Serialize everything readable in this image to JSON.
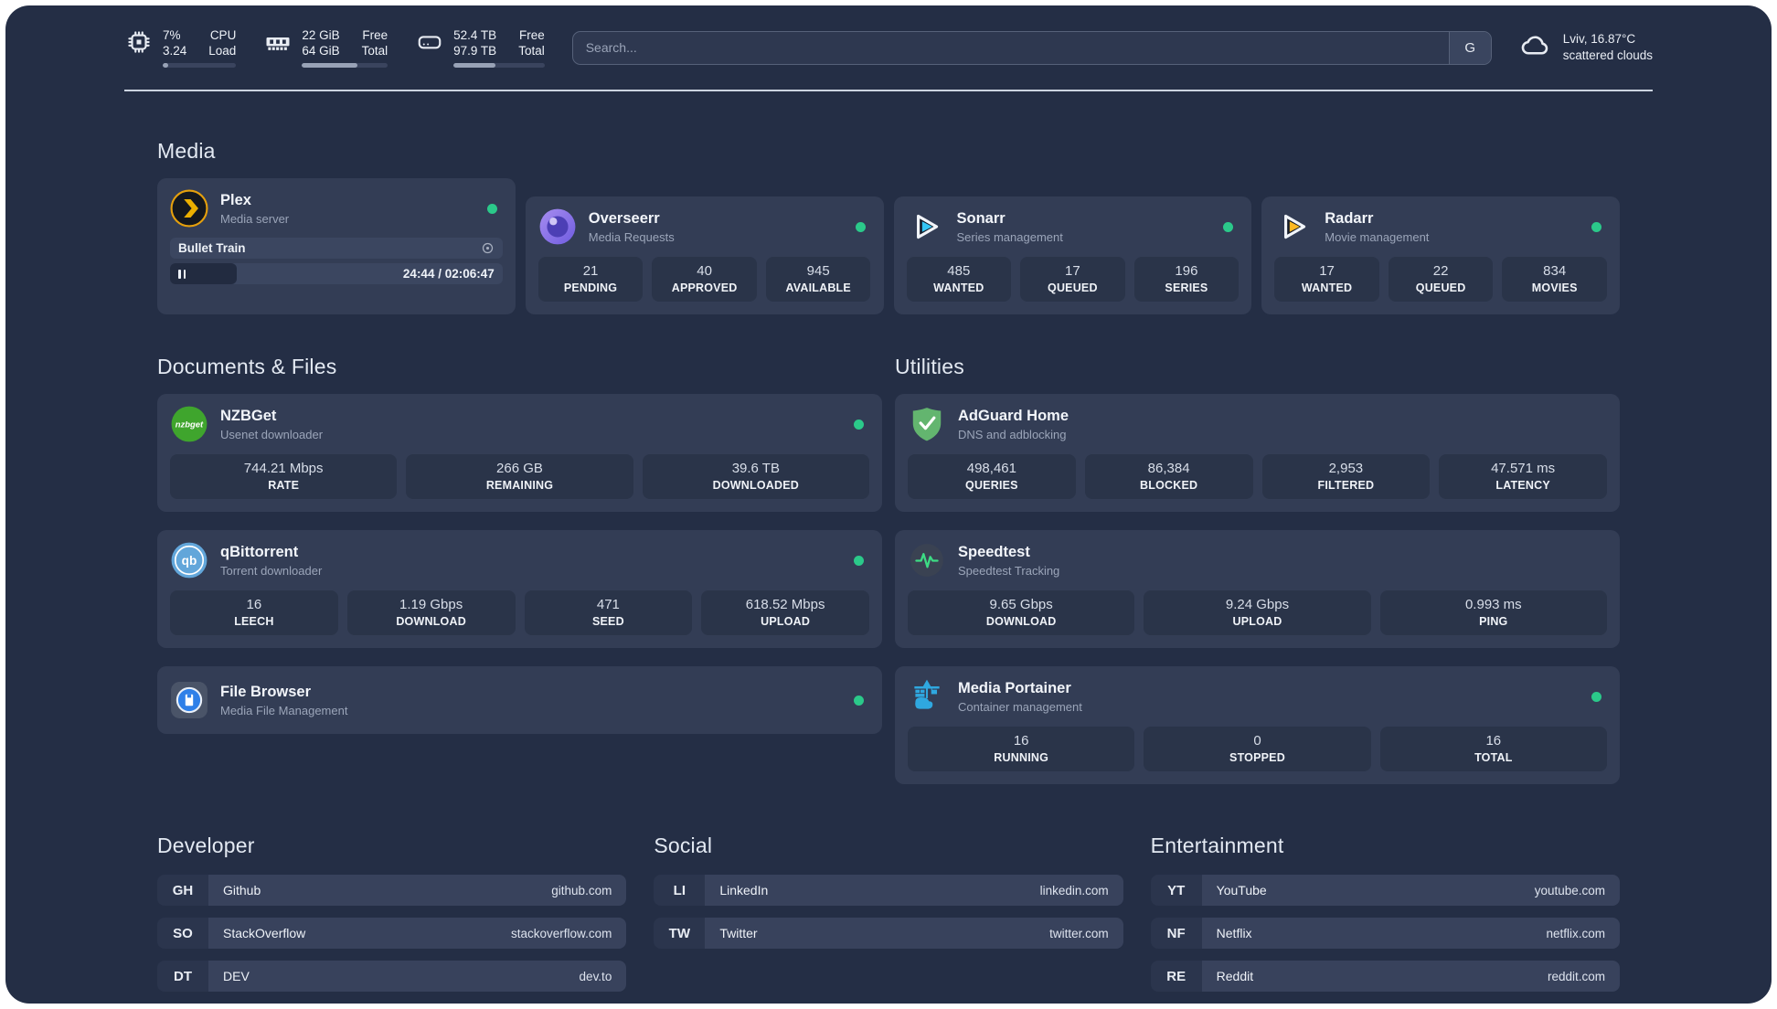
{
  "header": {
    "cpu": {
      "icon": "cpu-icon",
      "values": [
        "7%",
        "3.24"
      ],
      "labels": [
        "CPU",
        "Load"
      ],
      "progress": 7
    },
    "memory": {
      "icon": "ram-icon",
      "values": [
        "22 GiB",
        "64 GiB"
      ],
      "labels": [
        "Free",
        "Total"
      ],
      "progress": 65
    },
    "disk": {
      "icon": "disk-icon",
      "values": [
        "52.4 TB",
        "97.9 TB"
      ],
      "labels": [
        "Free",
        "Total"
      ],
      "progress": 46
    },
    "search": {
      "placeholder": "Search...",
      "engine_button": "G"
    },
    "weather": {
      "icon": "cloud-icon",
      "location": "Lviv, 16.87°C",
      "condition": "scattered clouds"
    }
  },
  "colors": {
    "status_online": "#2bc98a",
    "background": "#242e45",
    "card": "#333d55",
    "tile": "#2a3449"
  },
  "sections": {
    "media": {
      "title": "Media",
      "cards": [
        {
          "title": "Plex",
          "subtitle": "Media server",
          "icon": "plex-icon",
          "status": "online",
          "player": {
            "title": "Bullet Train",
            "time": "24:44 / 02:06:47",
            "progress_pct": 20
          }
        },
        {
          "title": "Overseerr",
          "subtitle": "Media Requests",
          "icon": "overseerr-icon",
          "status": "online",
          "stats": [
            {
              "value": "21",
              "label": "PENDING"
            },
            {
              "value": "40",
              "label": "APPROVED"
            },
            {
              "value": "945",
              "label": "AVAILABLE"
            }
          ]
        },
        {
          "title": "Sonarr",
          "subtitle": "Series management",
          "icon": "sonarr-icon",
          "status": "online",
          "stats": [
            {
              "value": "485",
              "label": "WANTED"
            },
            {
              "value": "17",
              "label": "QUEUED"
            },
            {
              "value": "196",
              "label": "SERIES"
            }
          ]
        },
        {
          "title": "Radarr",
          "subtitle": "Movie management",
          "icon": "radarr-icon",
          "status": "online",
          "stats": [
            {
              "value": "17",
              "label": "WANTED"
            },
            {
              "value": "22",
              "label": "QUEUED"
            },
            {
              "value": "834",
              "label": "MOVIES"
            }
          ]
        }
      ]
    },
    "documents": {
      "title": "Documents & Files",
      "cards": [
        {
          "title": "NZBGet",
          "subtitle": "Usenet downloader",
          "icon": "nzbget-icon",
          "status": "online",
          "stats": [
            {
              "value": "744.21 Mbps",
              "label": "RATE"
            },
            {
              "value": "266 GB",
              "label": "REMAINING"
            },
            {
              "value": "39.6 TB",
              "label": "DOWNLOADED"
            }
          ]
        },
        {
          "title": "qBittorrent",
          "subtitle": "Torrent downloader",
          "icon": "qbittorrent-icon",
          "status": "online",
          "stats": [
            {
              "value": "16",
              "label": "LEECH"
            },
            {
              "value": "1.19 Gbps",
              "label": "DOWNLOAD"
            },
            {
              "value": "471",
              "label": "SEED"
            },
            {
              "value": "618.52 Mbps",
              "label": "UPLOAD"
            }
          ]
        },
        {
          "title": "File Browser",
          "subtitle": "Media File Management",
          "icon": "filebrowser-icon",
          "status": "online",
          "stats": []
        }
      ]
    },
    "utilities": {
      "title": "Utilities",
      "cards": [
        {
          "title": "AdGuard Home",
          "subtitle": "DNS and adblocking",
          "icon": "adguard-icon",
          "stats": [
            {
              "value": "498,461",
              "label": "QUERIES"
            },
            {
              "value": "86,384",
              "label": "BLOCKED"
            },
            {
              "value": "2,953",
              "label": "FILTERED"
            },
            {
              "value": "47.571 ms",
              "label": "LATENCY"
            }
          ]
        },
        {
          "title": "Speedtest",
          "subtitle": "Speedtest Tracking",
          "icon": "speedtest-icon",
          "stats": [
            {
              "value": "9.65 Gbps",
              "label": "DOWNLOAD"
            },
            {
              "value": "9.24 Gbps",
              "label": "UPLOAD"
            },
            {
              "value": "0.993 ms",
              "label": "PING"
            }
          ]
        },
        {
          "title": "Media Portainer",
          "subtitle": "Container management",
          "icon": "portainer-icon",
          "status": "online",
          "stats": [
            {
              "value": "16",
              "label": "RUNNING"
            },
            {
              "value": "0",
              "label": "STOPPED"
            },
            {
              "value": "16",
              "label": "TOTAL"
            }
          ]
        }
      ]
    },
    "developer": {
      "title": "Developer",
      "links": [
        {
          "abbr": "GH",
          "name": "Github",
          "url": "github.com"
        },
        {
          "abbr": "SO",
          "name": "StackOverflow",
          "url": "stackoverflow.com"
        },
        {
          "abbr": "DT",
          "name": "DEV",
          "url": "dev.to"
        }
      ]
    },
    "social": {
      "title": "Social",
      "links": [
        {
          "abbr": "LI",
          "name": "LinkedIn",
          "url": "linkedin.com"
        },
        {
          "abbr": "TW",
          "name": "Twitter",
          "url": "twitter.com"
        }
      ]
    },
    "entertainment": {
      "title": "Entertainment",
      "links": [
        {
          "abbr": "YT",
          "name": "YouTube",
          "url": "youtube.com"
        },
        {
          "abbr": "NF",
          "name": "Netflix",
          "url": "netflix.com"
        },
        {
          "abbr": "RE",
          "name": "Reddit",
          "url": "reddit.com"
        }
      ]
    }
  }
}
